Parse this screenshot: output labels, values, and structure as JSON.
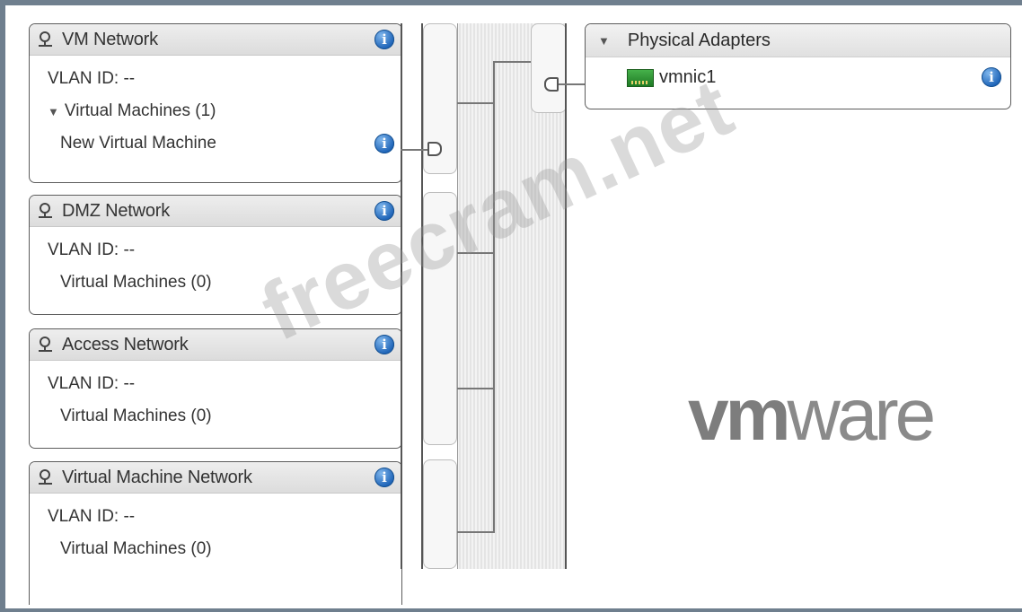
{
  "port_groups": [
    {
      "name": "VM Network",
      "vlan": "VLAN ID: --",
      "vms_label": "Virtual Machines (1)",
      "vms_expanded": true,
      "vms": [
        "New Virtual Machine"
      ]
    },
    {
      "name": "DMZ Network",
      "vlan": "VLAN ID: --",
      "vms_label": "Virtual Machines (0)",
      "vms_expanded": false,
      "vms": []
    },
    {
      "name": "Access Network",
      "vlan": "VLAN ID: --",
      "vms_label": "Virtual Machines (0)",
      "vms_expanded": false,
      "vms": []
    },
    {
      "name": "Virtual Machine Network",
      "vlan": "VLAN ID: --",
      "vms_label": "Virtual Machines (0)",
      "vms_expanded": false,
      "vms": []
    }
  ],
  "physical_adapters": {
    "title": "Physical Adapters",
    "adapters": [
      "vmnic1"
    ]
  },
  "branding": {
    "logo_bold": "vm",
    "logo_light": "ware"
  },
  "watermark": "freecram.net",
  "icons": {
    "network": "network-icon",
    "info": "info-icon",
    "nic": "nic-icon",
    "expand": "triangle-down-icon"
  },
  "colors": {
    "info_blue": "#1e64b8",
    "nic_green": "#2e9a34",
    "frame": "#6f7f8e"
  }
}
